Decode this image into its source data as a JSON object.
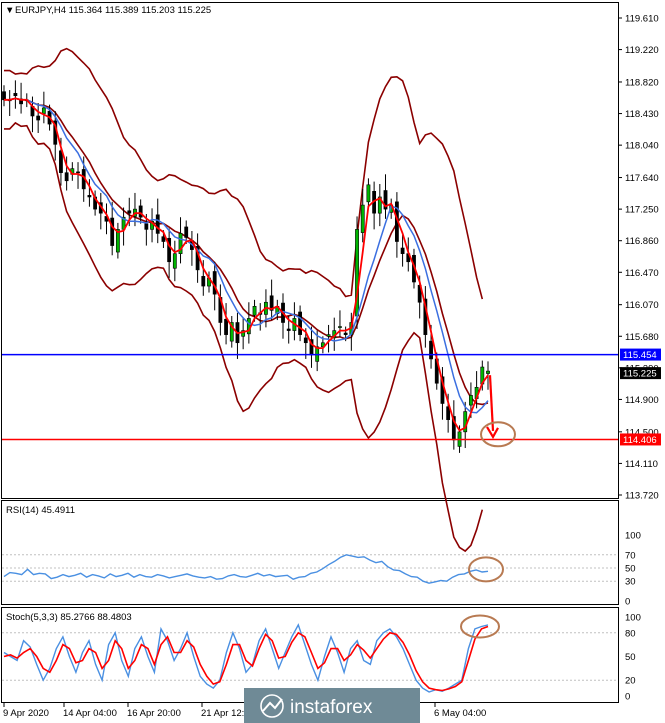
{
  "chart_data": [
    {
      "type": "candlestick",
      "title": "EURJPY,H4  115.364 115.389 115.203 115.225",
      "ylim": [
        113.72,
        119.8
      ],
      "y_ticks": [
        "119.610",
        "119.220",
        "118.820",
        "118.430",
        "118.040",
        "117.640",
        "117.250",
        "116.860",
        "116.470",
        "116.070",
        "115.680",
        "115.290",
        "114.900",
        "114.500",
        "114.110",
        "113.720"
      ],
      "x_ticks": [
        "9 Apr 2020",
        "14 Apr 04:00",
        "16 Apr 20:00",
        "21 Apr 12:00",
        "6 May 04:00"
      ],
      "close_path": [
        118.6,
        118.6,
        118.65,
        118.55,
        118.6,
        118.4,
        118.35,
        118.5,
        118.3,
        118.05,
        117.7,
        117.6,
        117.75,
        117.7,
        117.5,
        117.4,
        117.25,
        117.2,
        117.1,
        116.8,
        117.0,
        117.15,
        117.2,
        117.25,
        117.15,
        117.0,
        117.1,
        116.95,
        116.85,
        116.6,
        116.7,
        116.95,
        116.9,
        116.75,
        116.5,
        116.3,
        116.4,
        116.2,
        115.85,
        115.7,
        115.85,
        115.6,
        115.75,
        115.9,
        116.05,
        115.95,
        116.1,
        116.0,
        116.05,
        115.85,
        115.75,
        115.9,
        115.7,
        115.6,
        115.45,
        115.55,
        115.6,
        115.7,
        115.75,
        115.8,
        115.7,
        115.85,
        117.0,
        117.3,
        117.55,
        117.2,
        117.4,
        117.25,
        117.3,
        116.85,
        116.7,
        116.6,
        116.35,
        116.1,
        115.7,
        115.4,
        115.1,
        114.85,
        114.65,
        114.4,
        114.5,
        114.75,
        114.95,
        115.05,
        115.3,
        115.25
      ],
      "levels": [
        {
          "label": "115.454",
          "value": 115.454,
          "color": "#0000ff"
        },
        {
          "label": "114.406",
          "value": 114.406,
          "color": "#ff0000"
        }
      ],
      "current_price": {
        "label": "115.225",
        "value": 115.225
      },
      "forecast_arrow": {
        "from": 115.2,
        "to": 114.45
      }
    },
    {
      "type": "line",
      "title": "RSI(14) 45.4911",
      "ylim": [
        0,
        100
      ],
      "y_ticks": [
        "100",
        "70",
        "50",
        "30",
        "0"
      ],
      "series": [
        {
          "color": "#4a90e2",
          "values": [
            37,
            43,
            42,
            40,
            48,
            40,
            42,
            41,
            34,
            36,
            40,
            37,
            39,
            42,
            36,
            40,
            38,
            35,
            41,
            37,
            39,
            42,
            36,
            40,
            37,
            36,
            40,
            38,
            35,
            37,
            39,
            41,
            38,
            36,
            35,
            37,
            33,
            34,
            38,
            40,
            37,
            36,
            39,
            42,
            38,
            40,
            37,
            38,
            39,
            33,
            36,
            37,
            42,
            44,
            49,
            55,
            60,
            66,
            70,
            68,
            66,
            67,
            62,
            58,
            60,
            52,
            47,
            46,
            41,
            37,
            36,
            30,
            27,
            29,
            31,
            30,
            36,
            40,
            41,
            45,
            47,
            44,
            45
          ]
        }
      ]
    },
    {
      "type": "line",
      "title": "Stoch(5,3,3) 85.2766 88.4803",
      "ylim": [
        0,
        100
      ],
      "y_ticks": [
        "100",
        "80",
        "50",
        "20",
        "0"
      ],
      "series": [
        {
          "color": "#4a90e2",
          "values": [
            55,
            50,
            45,
            70,
            62,
            40,
            20,
            35,
            60,
            75,
            50,
            30,
            55,
            70,
            40,
            20,
            65,
            80,
            45,
            25,
            60,
            75,
            50,
            30,
            85,
            70,
            45,
            60,
            80,
            50,
            25,
            15,
            10,
            20,
            55,
            80,
            60,
            30,
            40,
            70,
            85,
            60,
            35,
            55,
            75,
            90,
            65,
            40,
            20,
            50,
            75,
            55,
            30,
            60,
            70,
            45,
            40,
            70,
            80,
            85,
            75,
            60,
            40,
            20,
            10,
            5,
            8,
            6,
            10,
            15,
            20,
            60,
            85,
            88,
            90
          ]
        },
        {
          "color": "#ff0000",
          "values": [
            50,
            52,
            48,
            55,
            60,
            50,
            35,
            30,
            45,
            65,
            60,
            42,
            45,
            60,
            55,
            35,
            45,
            70,
            60,
            35,
            45,
            65,
            60,
            40,
            65,
            75,
            55,
            55,
            70,
            62,
            40,
            25,
            15,
            18,
            40,
            65,
            65,
            45,
            38,
            60,
            78,
            70,
            48,
            50,
            68,
            80,
            75,
            55,
            35,
            42,
            60,
            60,
            45,
            52,
            65,
            58,
            48,
            60,
            72,
            80,
            78,
            68,
            52,
            32,
            18,
            10,
            8,
            7,
            9,
            12,
            18,
            45,
            72,
            85,
            88
          ]
        }
      ]
    }
  ],
  "watermark": "instaforex"
}
